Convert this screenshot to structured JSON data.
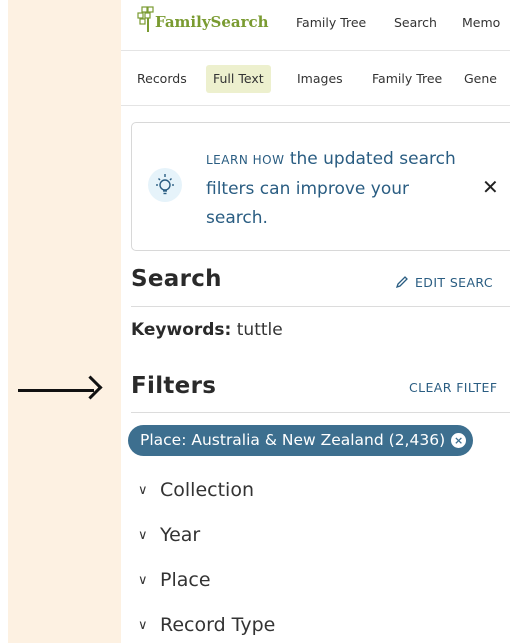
{
  "header": {
    "logo_text": "FamilySearch",
    "nav": [
      "Family Tree",
      "Search",
      "Memo"
    ]
  },
  "tabs": [
    "Records",
    "Full Text",
    "Images",
    "Family Tree",
    "Gene"
  ],
  "active_tab": "Full Text",
  "banner": {
    "learn_how": "LEARN HOW",
    "message": " the updated search filters can improve your search.",
    "close": "✕"
  },
  "search": {
    "title": "Search",
    "edit_label": "EDIT SEARC",
    "keywords_label": "Keywords:",
    "keywords_value": " tuttle"
  },
  "filters": {
    "title": "Filters",
    "clear_label": "CLEAR FILTEF",
    "chip_label": "Place: Australia & New Zealand (2,436)",
    "chip_remove": "×",
    "facets": [
      "Collection",
      "Year",
      "Place",
      "Record Type"
    ]
  },
  "colors": {
    "accent": "#2a5d82",
    "chip": "#3d6f8f",
    "logo": "#7a9b31",
    "active_tab_bg": "#edf0ce",
    "annotation_panel": "#fdf1e2"
  },
  "icons": [
    "arrow-right-icon",
    "family-tree-logo-icon",
    "lightbulb-icon",
    "close-icon",
    "pencil-icon",
    "chevron-down-icon"
  ]
}
